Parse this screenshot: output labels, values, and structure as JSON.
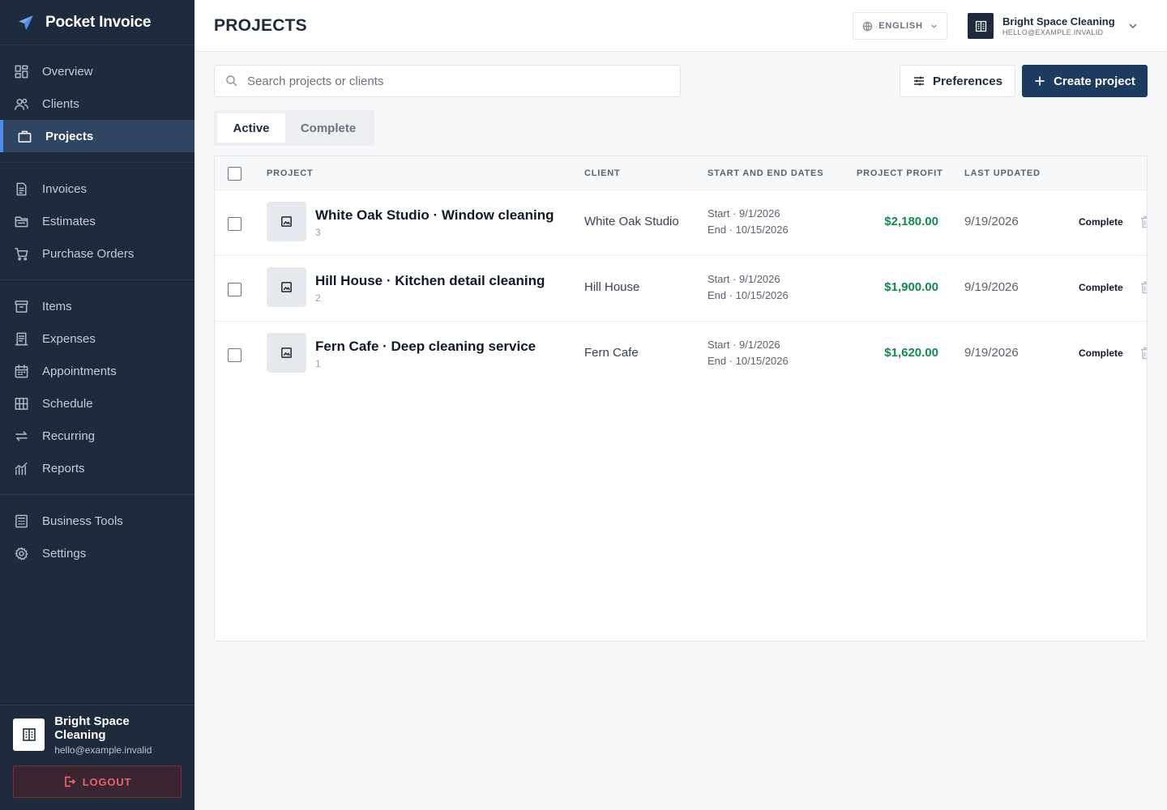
{
  "app": {
    "name": "Pocket Invoice"
  },
  "sidebar": {
    "groups": [
      [
        {
          "label": "Overview",
          "icon": "dashboard-icon"
        },
        {
          "label": "Clients",
          "icon": "users-icon"
        },
        {
          "label": "Projects",
          "icon": "briefcase-icon",
          "active": true
        }
      ],
      [
        {
          "label": "Invoices",
          "icon": "document-icon"
        },
        {
          "label": "Estimates",
          "icon": "folder-icon"
        },
        {
          "label": "Purchase Orders",
          "icon": "cart-icon"
        }
      ],
      [
        {
          "label": "Items",
          "icon": "archive-icon"
        },
        {
          "label": "Expenses",
          "icon": "receipt-icon"
        },
        {
          "label": "Appointments",
          "icon": "calendar-icon"
        },
        {
          "label": "Schedule",
          "icon": "grid-icon"
        },
        {
          "label": "Recurring",
          "icon": "repeat-icon"
        },
        {
          "label": "Reports",
          "icon": "chart-icon"
        }
      ],
      [
        {
          "label": "Business Tools",
          "icon": "calculator-icon"
        },
        {
          "label": "Settings",
          "icon": "gear-icon"
        }
      ]
    ],
    "account": {
      "name": "Bright Space Cleaning",
      "email": "hello@example.invalid"
    },
    "logout_label": "LOGOUT"
  },
  "header": {
    "title": "PROJECTS",
    "language": "ENGLISH",
    "business_name": "Bright Space Cleaning",
    "business_email": "HELLO@EXAMPLE.INVALID"
  },
  "toolbar": {
    "search_placeholder": "Search projects or clients",
    "preferences_label": "Preferences",
    "create_label": "Create project"
  },
  "tabs": {
    "active": "Active",
    "complete": "Complete"
  },
  "table": {
    "columns": {
      "project": "PROJECT",
      "client": "CLIENT",
      "dates": "START AND END DATES",
      "profit": "PROJECT PROFIT",
      "updated": "LAST UPDATED"
    },
    "rows": [
      {
        "name": "White Oak Studio · Window cleaning",
        "count": "3",
        "client": "White Oak Studio",
        "start": "Start · 9/1/2026",
        "end": "End · 10/15/2026",
        "profit": "$2,180.00",
        "updated": "9/19/2026",
        "action": "Complete"
      },
      {
        "name": "Hill House · Kitchen detail cleaning",
        "count": "2",
        "client": "Hill House",
        "start": "Start · 9/1/2026",
        "end": "End · 10/15/2026",
        "profit": "$1,900.00",
        "updated": "9/19/2026",
        "action": "Complete"
      },
      {
        "name": "Fern Cafe · Deep cleaning service",
        "count": "1",
        "client": "Fern Cafe",
        "start": "Start · 9/1/2026",
        "end": "End · 10/15/2026",
        "profit": "$1,620.00",
        "updated": "9/19/2026",
        "action": "Complete"
      }
    ]
  },
  "colors": {
    "sidebar_bg": "#1d2b3c",
    "accent": "#1d3a5f",
    "profit": "#118a4e",
    "logout": "#e8636a"
  }
}
